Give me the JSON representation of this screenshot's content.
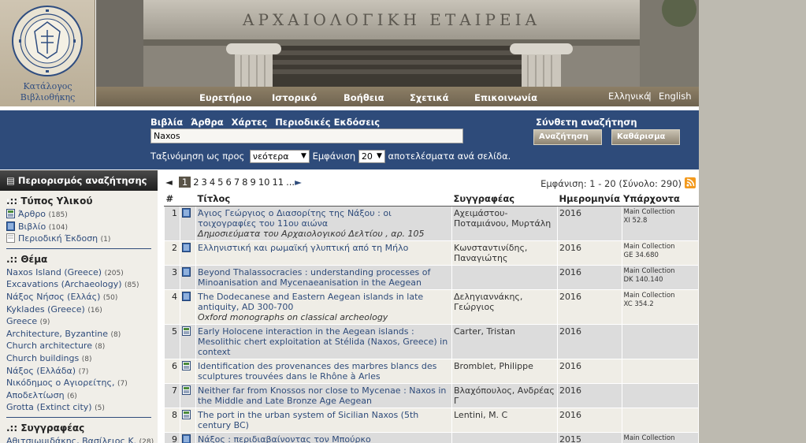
{
  "logo": {
    "line1": "Κατάλογος",
    "line2": "Βιβλιοθήκης"
  },
  "banner": {
    "inscription": "ΑΡΧΑΙΟΛΟΓΙΚΗ ΕΤΑΙΡΕΙΑ"
  },
  "nav": {
    "items": [
      "Ευρετήριο",
      "Ιστορικό",
      "Βοήθεια",
      "Σχετικά",
      "Επικοινωνία"
    ],
    "lang_el": "Ελληνικά",
    "lang_sep": "|",
    "lang_en": "English"
  },
  "search": {
    "tabs": [
      "Βιβλία",
      "Άρθρα",
      "Χάρτες",
      "Περιοδικές Εκδόσεις"
    ],
    "value": "Naxos",
    "sort_label": "Ταξινόμηση ως προς",
    "sort_value": "νεότερα",
    "show_label": "Εμφάνιση",
    "per_page": "20",
    "per_page_suffix": "αποτελέσματα ανά σελίδα.",
    "advanced": "Σύνθετη αναζήτηση",
    "search_button": "Αναζήτηση",
    "clear_button": "Καθάρισμα"
  },
  "sidebar": {
    "header": "Περιορισμός αναζήτησης με:",
    "material": {
      "title": ".:: Τύπος Υλικού",
      "items": [
        {
          "label": "Άρθρο",
          "count": "(185)",
          "icon": "article-icon"
        },
        {
          "label": "Βιβλίο",
          "count": "(104)",
          "icon": "book-icon"
        },
        {
          "label": "Περιοδική Έκδοση",
          "count": "(1)",
          "icon": "periodical-icon"
        }
      ]
    },
    "subject": {
      "title": ".:: Θέμα",
      "items": [
        {
          "label": "Naxos Island (Greece)",
          "count": "(205)"
        },
        {
          "label": "Excavations (Archaeology)",
          "count": "(85)"
        },
        {
          "label": "Νάξος Νήσος (Ελλάς)",
          "count": "(50)"
        },
        {
          "label": "Kyklades (Greece)",
          "count": "(16)"
        },
        {
          "label": "Greece",
          "count": "(9)"
        },
        {
          "label": "Architecture, Byzantine",
          "count": "(8)"
        },
        {
          "label": "Church architecture",
          "count": "(8)"
        },
        {
          "label": "Church buildings",
          "count": "(8)"
        },
        {
          "label": "Νάξος (Ελλάδα)",
          "count": "(7)"
        },
        {
          "label": "Νικόδημος ο Αγιορείτης,",
          "count": "(7)"
        },
        {
          "label": "Αποδελτίωση",
          "count": "(6)"
        },
        {
          "label": "Grotta (Extinct city)",
          "count": "(5)"
        }
      ]
    },
    "authors": {
      "title": ".:: Συγγραφέας",
      "items": [
        {
          "label": "Αθιτσιωμιδάκης, Βασίλειος Κ.",
          "count": "(28)"
        }
      ]
    }
  },
  "pager": {
    "current": "1",
    "pages": [
      "2",
      "3",
      "4",
      "5",
      "6",
      "7",
      "8",
      "9",
      "10",
      "11"
    ],
    "ellipsis": "..."
  },
  "count": "Εμφάνιση: 1 - 20 (Σύνολο: 290)",
  "table": {
    "headers": {
      "num": "#",
      "title": "Τίτλος",
      "author": "Συγγραφέας",
      "date": "Ημερομηνία",
      "holdings": "Υπάρχοντα"
    },
    "rows": [
      {
        "num": "1",
        "type": "book",
        "title": "Άγιος Γεώργιος ο Διασορίτης της Νάξου : οι τοιχογραφίες του 11ου αιώνα",
        "sub": "Δημοσιεύματα του Αρχαιολογικού Δελτίου , αρ. 105",
        "author": "Αχειμάστου-Ποταμιάνου, Μυρτάλη",
        "date": "2016",
        "hold1": "Main Collection",
        "hold2": "XI 52.8"
      },
      {
        "num": "2",
        "type": "book",
        "title": "Ελληνιστική και ρωμαϊκή γλυπτική από τη Μήλο",
        "sub": "",
        "author": "Κωνσταντινίδης, Παναγιώτης",
        "date": "2016",
        "hold1": "Main Collection",
        "hold2": "GE 34.680"
      },
      {
        "num": "3",
        "type": "book",
        "title": "Beyond Thalassocracies : understanding processes of Minoanisation and Mycenaeanisation in the Aegean",
        "sub": "",
        "author": "",
        "date": "2016",
        "hold1": "Main Collection",
        "hold2": "DK 140.140"
      },
      {
        "num": "4",
        "type": "book",
        "title": "The Dodecanese and Eastern Aegean islands in late antiquity, AD 300-700",
        "sub": "Oxford monographs on classical archeology",
        "author": "Δεληγιαννάκης, Γεώργιος",
        "date": "2016",
        "hold1": "Main Collection",
        "hold2": "XC 354.2"
      },
      {
        "num": "5",
        "type": "article",
        "title": "Early Holocene interaction in the Aegean islands : Mesolithic chert exploitation at Stélida (Naxos, Greece) in context",
        "sub": "",
        "author": "Carter, Tristan",
        "date": "2016",
        "hold1": "",
        "hold2": ""
      },
      {
        "num": "6",
        "type": "article",
        "title": "Identification des provenances des marbres blancs des sculptures trouvées dans le Rhône à Arles",
        "sub": "",
        "author": "Bromblet, Philippe",
        "date": "2016",
        "hold1": "",
        "hold2": ""
      },
      {
        "num": "7",
        "type": "article",
        "title": "Neither far from Knossos nor close to Mycenae : Naxos in the Middle and Late Bronze Age Aegean",
        "sub": "",
        "author": "Βλαχόπουλος, Ανδρέας Γ",
        "date": "2016",
        "hold1": "",
        "hold2": ""
      },
      {
        "num": "8",
        "type": "article",
        "title": "The port in the urban system of Sicilian Naxos (5th century BC)",
        "sub": "",
        "author": "Lentini, M. C",
        "date": "2016",
        "hold1": "",
        "hold2": ""
      },
      {
        "num": "9",
        "type": "book",
        "title": "Νάξος : περιδιαβαίνοντας τον Μπούρκο",
        "sub": "",
        "author": "",
        "date": "2015",
        "hold1": "Main Collection",
        "hold2": ""
      }
    ]
  }
}
